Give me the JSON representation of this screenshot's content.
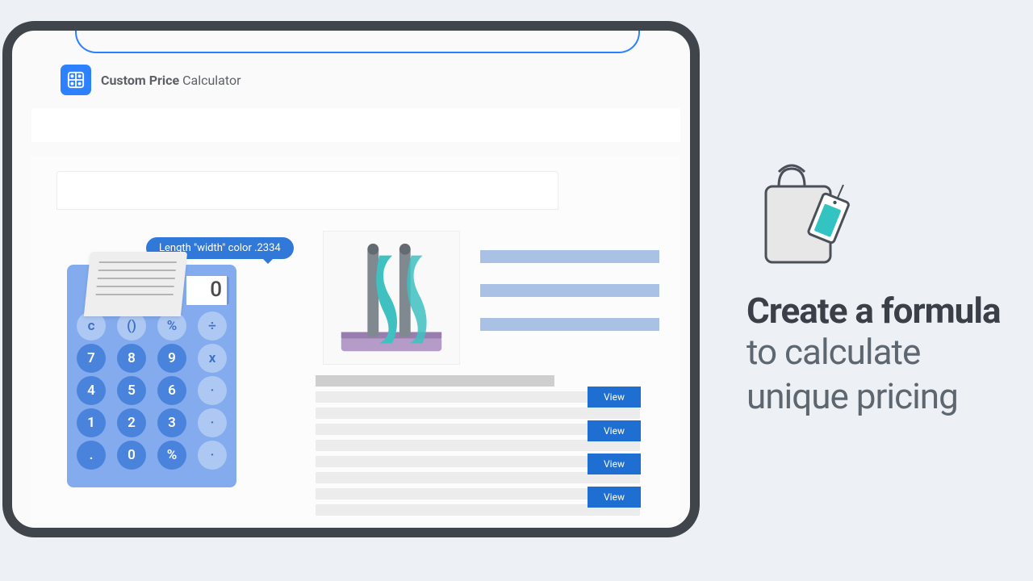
{
  "app": {
    "title_bold": "Custom Price",
    "title_light": " Calculator"
  },
  "calculator": {
    "tooltip": "Length \"width\" color .2334",
    "display": "0",
    "rows": [
      [
        {
          "label": "c",
          "op": true
        },
        {
          "label": "()",
          "op": true
        },
        {
          "label": "%",
          "op": true
        },
        {
          "label": "÷",
          "op": true
        }
      ],
      [
        {
          "label": "7",
          "op": false
        },
        {
          "label": "8",
          "op": false
        },
        {
          "label": "9",
          "op": false
        },
        {
          "label": "x",
          "op": true
        }
      ],
      [
        {
          "label": "4",
          "op": false
        },
        {
          "label": "5",
          "op": false
        },
        {
          "label": "6",
          "op": false
        },
        {
          "label": "·",
          "op": true
        }
      ],
      [
        {
          "label": "1",
          "op": false
        },
        {
          "label": "2",
          "op": false
        },
        {
          "label": "3",
          "op": false
        },
        {
          "label": "·",
          "op": true
        }
      ],
      [
        {
          "label": ".",
          "op": false
        },
        {
          "label": "0",
          "op": false
        },
        {
          "label": "%",
          "op": false
        },
        {
          "label": "·",
          "op": true
        }
      ]
    ]
  },
  "list": {
    "view_label": "View",
    "buttons": 4
  },
  "marketing": {
    "headline_bold": "Create a formula",
    "headline_line2": "to calculate",
    "headline_line3": "unique pricing"
  }
}
